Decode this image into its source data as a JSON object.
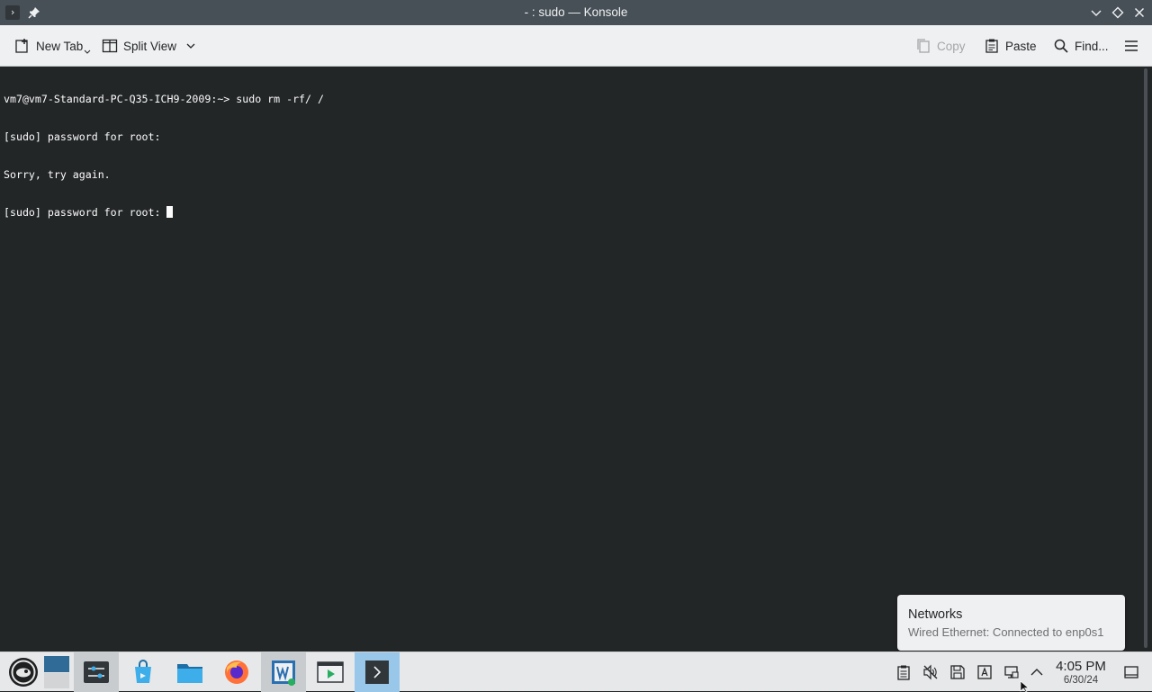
{
  "window": {
    "title": "- : sudo — Konsole",
    "icons": [
      "konsole-icon",
      "pin-icon",
      "minimize-icon",
      "maximize-icon",
      "close-icon"
    ]
  },
  "toolbar": {
    "new_tab_label": "New Tab",
    "split_view_label": "Split View",
    "copy_label": "Copy",
    "paste_label": "Paste",
    "find_label": "Find...",
    "icons": [
      "new-tab-icon",
      "split-view-icon",
      "chevron-down-icon",
      "copy-icon",
      "paste-icon",
      "search-icon",
      "hamburger-menu-icon"
    ]
  },
  "terminal": {
    "lines": [
      "vm7@vm7-Standard-PC-Q35-ICH9-2009:~> sudo rm -rf/ /",
      "[sudo] password for root:",
      "Sorry, try again.",
      "[sudo] password for root: "
    ]
  },
  "notification": {
    "title": "Networks",
    "body": "Wired Ethernet: Connected to enp0s1"
  },
  "taskbar": {
    "apps": [
      "application-launcher",
      "desktop-pager",
      "system-settings",
      "discover",
      "dolphin-file-manager",
      "firefox",
      "virtualbox-manager",
      "media-player",
      "konsole"
    ],
    "tray": [
      "clipboard-icon",
      "volume-muted-icon",
      "disk-icon",
      "input-method-icon",
      "network-wired-icon",
      "tray-expand-icon",
      "show-desktop-icon"
    ],
    "clock_time": "4:05 PM",
    "clock_date": "6/30/24"
  },
  "colors": {
    "titlebar_bg": "#475057",
    "terminal_bg": "#232627",
    "terminal_fg": "#fcfcfc",
    "toolbar_bg": "#eff0f1",
    "taskbar_bg": "#e7e8e9",
    "active_task": "#99c7ea"
  }
}
